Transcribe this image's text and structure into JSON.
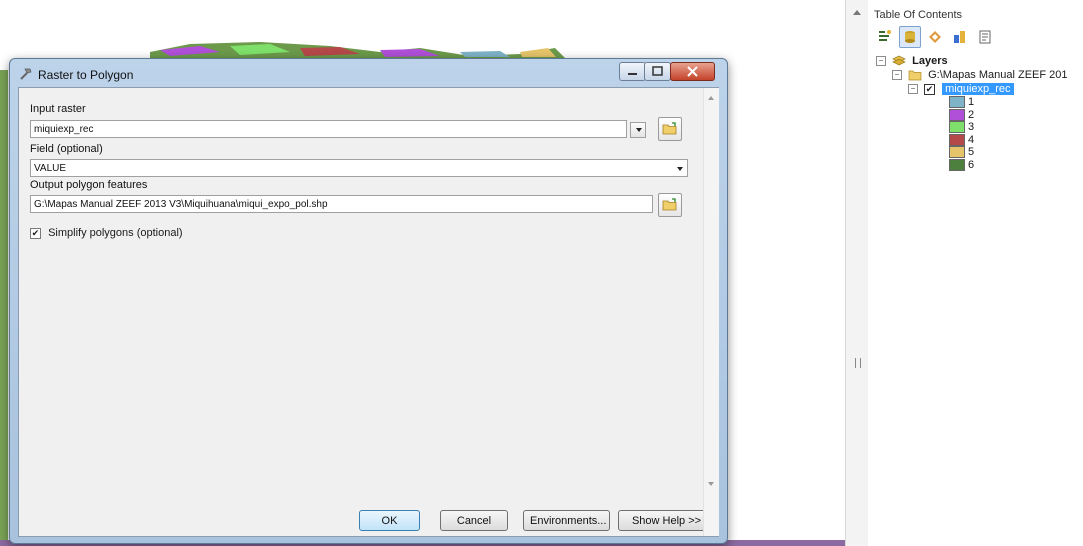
{
  "toc": {
    "title": "Table Of Contents",
    "root_label": "Layers",
    "folder_label": "G:\\Mapas  Manual ZEEF 201",
    "layer_label": "miquiexp_rec",
    "legend": [
      {
        "label": "1",
        "color": "#7fb3c8"
      },
      {
        "label": "2",
        "color": "#b04fd8"
      },
      {
        "label": "3",
        "color": "#7ee06a"
      },
      {
        "label": "4",
        "color": "#b54848"
      },
      {
        "label": "5",
        "color": "#e6c46a"
      },
      {
        "label": "6",
        "color": "#4d7f3f"
      }
    ]
  },
  "dialog": {
    "title": "Raster to Polygon",
    "input_raster_label": "Input raster",
    "input_raster_value": "miquiexp_rec",
    "field_label": "Field (optional)",
    "field_value": "VALUE",
    "output_label": "Output polygon features",
    "output_value": "G:\\Mapas  Manual ZEEF 2013 V3\\Miquihuana\\miqui_expo_pol.shp",
    "simplify_label": "Simplify polygons (optional)",
    "simplify_checked": true,
    "buttons": {
      "ok": "OK",
      "cancel": "Cancel",
      "environments": "Environments...",
      "show_help": "Show Help >>"
    }
  },
  "colors": {
    "selection": "#3399ff",
    "dialog_frame": "#bcd3ea",
    "close_button": "#c4432a"
  }
}
